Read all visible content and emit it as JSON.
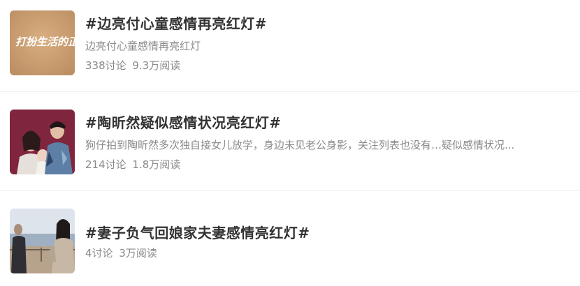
{
  "topics": [
    {
      "title": "#边亮付心童感情再亮红灯#",
      "description": "边亮付心童感情再亮红灯",
      "discussions": "338讨论",
      "reads": "9.3万阅读",
      "thumbnail": {
        "caption": "打扮生活的正确方式",
        "bg": "#c99c6e"
      }
    },
    {
      "title": "#陶昕然疑似感情状况亮红灯#",
      "description": "狗仔拍到陶昕然多次独自接女儿放学，身边未见老公身影，关注列表也没有…疑似感情状况...",
      "discussions": "214讨论",
      "reads": "1.8万阅读",
      "thumbnail": {
        "bg": "#7a2238"
      }
    },
    {
      "title": "#妻子负气回娘家夫妻感情亮红灯#",
      "discussions": "4讨论",
      "reads": "3万阅读",
      "thumbnail": {
        "bg": "#c8d2dc"
      }
    }
  ]
}
